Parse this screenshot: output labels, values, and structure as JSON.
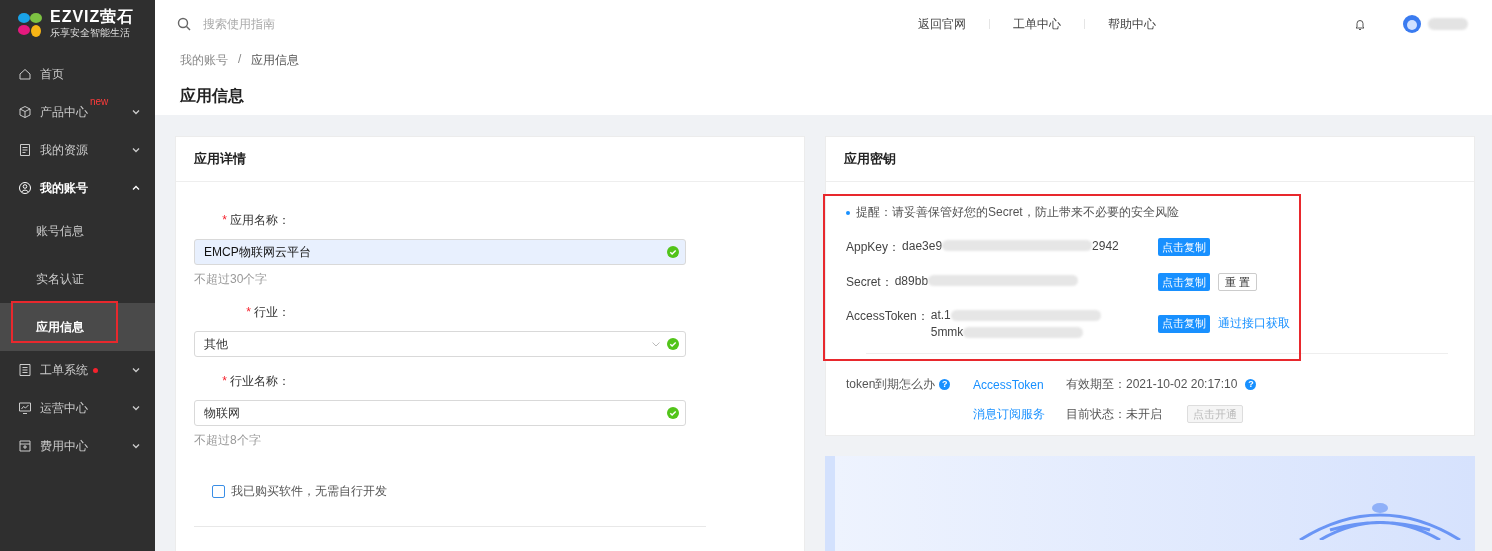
{
  "logo": {
    "brand": "EZVIZ萤石",
    "slogan": "乐享安全智能生活"
  },
  "sidebar": {
    "items": [
      {
        "label": "首页",
        "kind": "link",
        "expanded": false,
        "dot": false
      },
      {
        "label": "产品中心",
        "kind": "group",
        "badge": "new",
        "expanded": false,
        "dot": false
      },
      {
        "label": "我的资源",
        "kind": "group",
        "expanded": false,
        "dot": false
      },
      {
        "label": "我的账号",
        "kind": "group",
        "expanded": true,
        "dot": false,
        "children": [
          {
            "label": "账号信息",
            "selected": false,
            "highlighted": false
          },
          {
            "label": "实名认证",
            "selected": false,
            "highlighted": false
          },
          {
            "label": "应用信息",
            "selected": true,
            "highlighted": true
          }
        ]
      },
      {
        "label": "工单系统",
        "kind": "group",
        "expanded": false,
        "dot": true
      },
      {
        "label": "运营中心",
        "kind": "group",
        "expanded": false,
        "dot": false
      },
      {
        "label": "费用中心",
        "kind": "group",
        "expanded": false,
        "dot": false
      }
    ]
  },
  "topbar": {
    "search": {
      "placeholder": "搜索使用指南"
    },
    "links": [
      "返回官网",
      "工单中心",
      "帮助中心"
    ]
  },
  "breadcrumb": {
    "items": [
      "我的账号",
      "应用信息"
    ],
    "separator": "/"
  },
  "page_title": "应用信息",
  "detail_card": {
    "title": "应用详情",
    "fields": [
      {
        "label": "应用名称：",
        "required_mark": "*",
        "kind": "input",
        "value": "EMCP物联网云平台",
        "hint": "不超过30个字",
        "valid": true,
        "autofilled": true
      },
      {
        "label": "行业：",
        "required_mark": "*",
        "kind": "select",
        "value": "其他",
        "valid": true,
        "autofilled": false
      },
      {
        "label": "行业名称：",
        "required_mark": "*",
        "kind": "input",
        "value": "物联网",
        "hint": "不超过8个字",
        "valid": true,
        "autofilled": false
      }
    ],
    "checkbox": {
      "label": "我已购买软件，无需自行开发",
      "checked": false
    }
  },
  "key_card": {
    "title": "应用密钥",
    "highlighted": true,
    "notice": "提醒：请妥善保管好您的Secret，防止带来不必要的安全风险",
    "keys": [
      {
        "label": "AppKey：",
        "lines": [
          "dae3e9"
        ],
        "tail": "2942",
        "actions": [
          {
            "label": "点击复制",
            "kind": "primary"
          }
        ]
      },
      {
        "label": "Secret：",
        "lines": [
          "d89bb"
        ],
        "actions": [
          {
            "label": "点击复制",
            "kind": "primary"
          },
          {
            "label": "重 置",
            "kind": "default"
          }
        ]
      },
      {
        "label": "AccessToken：",
        "lines": [
          "at.1",
          "5mmk"
        ],
        "actions": [
          {
            "label": "点击复制",
            "kind": "primary"
          },
          {
            "label": "通过接口获取",
            "kind": "link"
          }
        ]
      }
    ],
    "token": {
      "question": "token到期怎么办",
      "question_help": "?",
      "link": "AccessToken",
      "expiry": "有效期至：2021-10-02 20:17:10",
      "expiry_help": "?"
    },
    "subscription": {
      "link": "消息订阅服务",
      "status": "目前状态：未开启",
      "button": {
        "label": "点击开通",
        "disabled": true
      }
    }
  }
}
